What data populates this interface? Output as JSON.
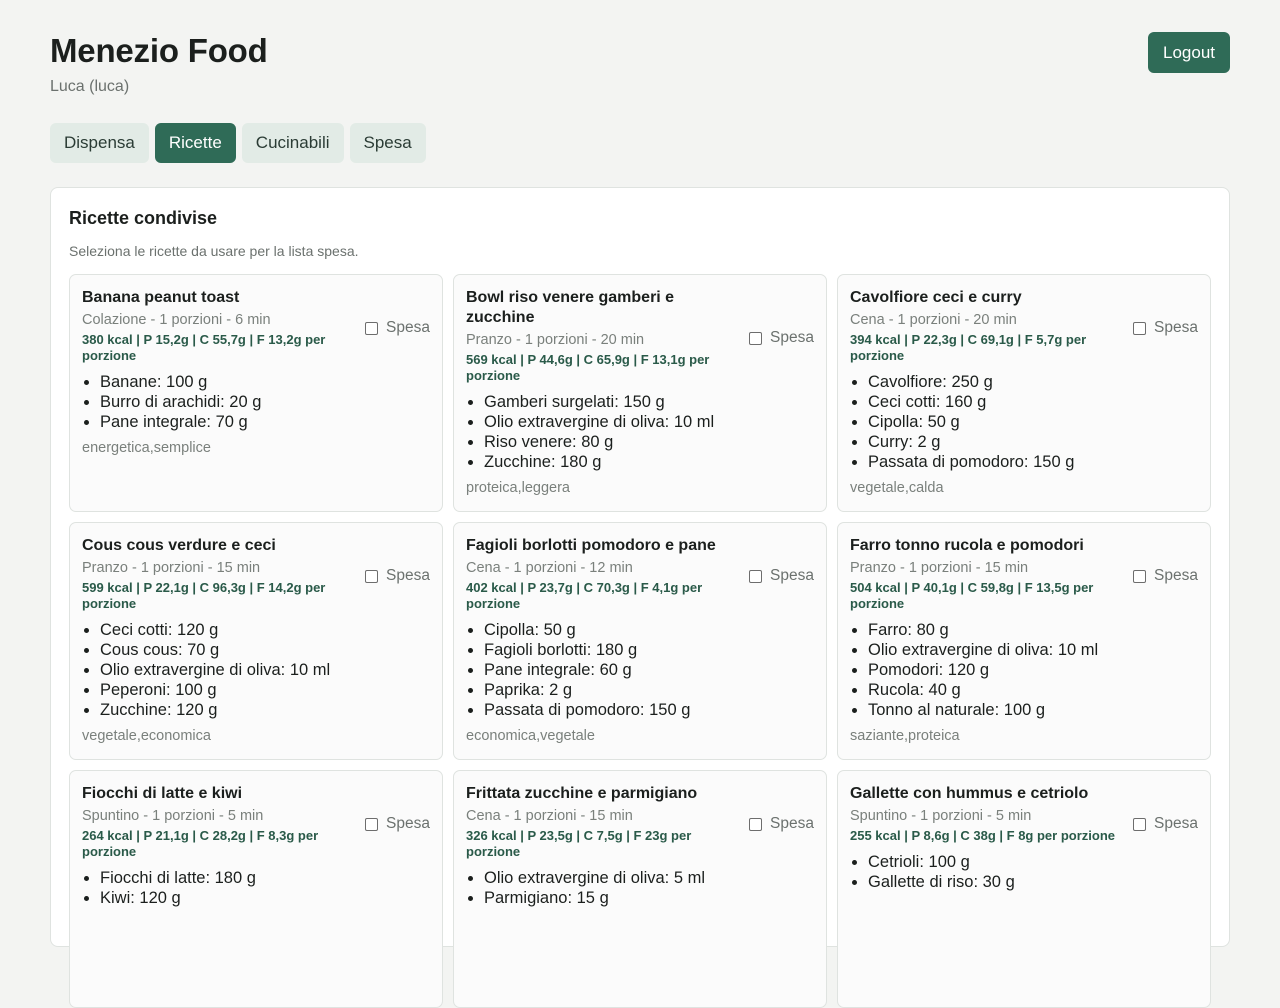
{
  "app": {
    "title": "Menezio Food",
    "user": "Luca (luca)",
    "logout_label": "Logout"
  },
  "tabs": [
    {
      "label": "Dispensa",
      "active": false
    },
    {
      "label": "Ricette",
      "active": true
    },
    {
      "label": "Cucinabili",
      "active": false
    },
    {
      "label": "Spesa",
      "active": false
    }
  ],
  "panel": {
    "title": "Ricette condivise",
    "subtitle": "Seleziona le ricette da usare per la lista spesa.",
    "checkbox_label": "Spesa"
  },
  "recipes": [
    {
      "name": "Banana peanut toast",
      "meta": "Colazione - 1 porzioni - 6 min",
      "macros": "380 kcal | P 15,2g | C 55,7g | F 13,2g per porzione",
      "ingredients": [
        "Banane: 100 g",
        "Burro di arachidi: 20 g",
        "Pane integrale: 70 g"
      ],
      "tags": "energetica,semplice",
      "selected": false
    },
    {
      "name": "Bowl riso venere gamberi e zucchine",
      "meta": "Pranzo - 1 porzioni - 20 min",
      "macros": "569 kcal | P 44,6g | C 65,9g | F 13,1g per porzione",
      "ingredients": [
        "Gamberi surgelati: 150 g",
        "Olio extravergine di oliva: 10 ml",
        "Riso venere: 80 g",
        "Zucchine: 180 g"
      ],
      "tags": "proteica,leggera",
      "selected": false
    },
    {
      "name": "Cavolfiore ceci e curry",
      "meta": "Cena - 1 porzioni - 20 min",
      "macros": "394 kcal | P 22,3g | C 69,1g | F 5,7g per porzione",
      "ingredients": [
        "Cavolfiore: 250 g",
        "Ceci cotti: 160 g",
        "Cipolla: 50 g",
        "Curry: 2 g",
        "Passata di pomodoro: 150 g"
      ],
      "tags": "vegetale,calda",
      "selected": false
    },
    {
      "name": "Cous cous verdure e ceci",
      "meta": "Pranzo - 1 porzioni - 15 min",
      "macros": "599 kcal | P 22,1g | C 96,3g | F 14,2g per porzione",
      "ingredients": [
        "Ceci cotti: 120 g",
        "Cous cous: 70 g",
        "Olio extravergine di oliva: 10 ml",
        "Peperoni: 100 g",
        "Zucchine: 120 g"
      ],
      "tags": "vegetale,economica",
      "selected": false
    },
    {
      "name": "Fagioli borlotti pomodoro e pane",
      "meta": "Cena - 1 porzioni - 12 min",
      "macros": "402 kcal | P 23,7g | C 70,3g | F 4,1g per porzione",
      "ingredients": [
        "Cipolla: 50 g",
        "Fagioli borlotti: 180 g",
        "Pane integrale: 60 g",
        "Paprika: 2 g",
        "Passata di pomodoro: 150 g"
      ],
      "tags": "economica,vegetale",
      "selected": false
    },
    {
      "name": "Farro tonno rucola e pomodori",
      "meta": "Pranzo - 1 porzioni - 15 min",
      "macros": "504 kcal | P 40,1g | C 59,8g | F 13,5g per porzione",
      "ingredients": [
        "Farro: 80 g",
        "Olio extravergine di oliva: 10 ml",
        "Pomodori: 120 g",
        "Rucola: 40 g",
        "Tonno al naturale: 100 g"
      ],
      "tags": "saziante,proteica",
      "selected": false
    },
    {
      "name": "Fiocchi di latte e kiwi",
      "meta": "Spuntino - 1 porzioni - 5 min",
      "macros": "264 kcal | P 21,1g | C 28,2g | F 8,3g per porzione",
      "ingredients": [
        "Fiocchi di latte: 180 g",
        "Kiwi: 120 g"
      ],
      "tags": "",
      "selected": false
    },
    {
      "name": "Frittata zucchine e parmigiano",
      "meta": "Cena - 1 porzioni - 15 min",
      "macros": "326 kcal | P 23,5g | C 7,5g | F 23g per porzione",
      "ingredients": [
        "Olio extravergine di oliva: 5 ml",
        "Parmigiano: 15 g"
      ],
      "tags": "",
      "selected": false
    },
    {
      "name": "Gallette con hummus e cetriolo",
      "meta": "Spuntino - 1 porzioni - 5 min",
      "macros": "255 kcal | P 8,6g | C 38g | F 8g per porzione",
      "ingredients": [
        "Cetrioli: 100 g",
        "Gallette di riso: 30 g"
      ],
      "tags": "",
      "selected": false
    }
  ]
}
